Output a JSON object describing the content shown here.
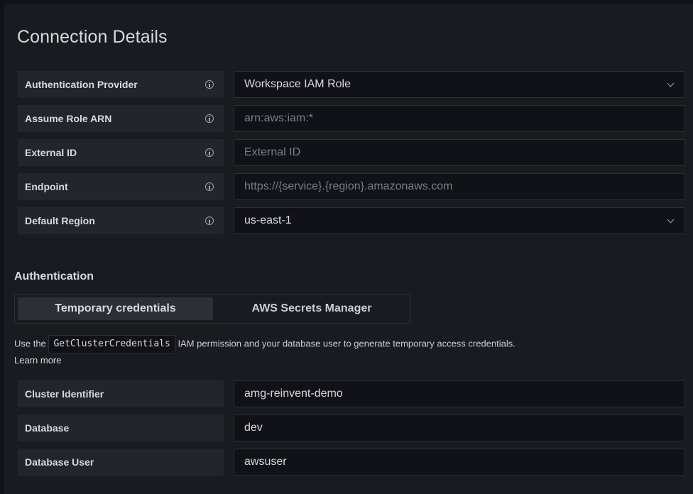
{
  "heading": "Connection Details",
  "connection_fields": [
    {
      "label": "Authentication Provider",
      "value": "Workspace IAM Role",
      "placeholder": "",
      "kind": "select"
    },
    {
      "label": "Assume Role ARN",
      "value": "",
      "placeholder": "arn:aws:iam:*",
      "kind": "input"
    },
    {
      "label": "External ID",
      "value": "",
      "placeholder": "External ID",
      "kind": "input"
    },
    {
      "label": "Endpoint",
      "value": "",
      "placeholder": "https://{service}.{region}.amazonaws.com",
      "kind": "input"
    },
    {
      "label": "Default Region",
      "value": "us-east-1",
      "placeholder": "",
      "kind": "select"
    }
  ],
  "authentication": {
    "heading": "Authentication",
    "tabs": [
      {
        "label": "Temporary credentials",
        "active": true
      },
      {
        "label": "AWS Secrets Manager",
        "active": false
      }
    ],
    "description_prefix": "Use the",
    "description_code": "GetClusterCredentials",
    "description_suffix": "IAM permission and your database user to generate temporary access credentials.",
    "learn_more": "Learn more"
  },
  "cluster_fields": [
    {
      "label": "Cluster Identifier",
      "value": "amg-reinvent-demo"
    },
    {
      "label": "Database",
      "value": "dev"
    },
    {
      "label": "Database User",
      "value": "awsuser"
    }
  ]
}
